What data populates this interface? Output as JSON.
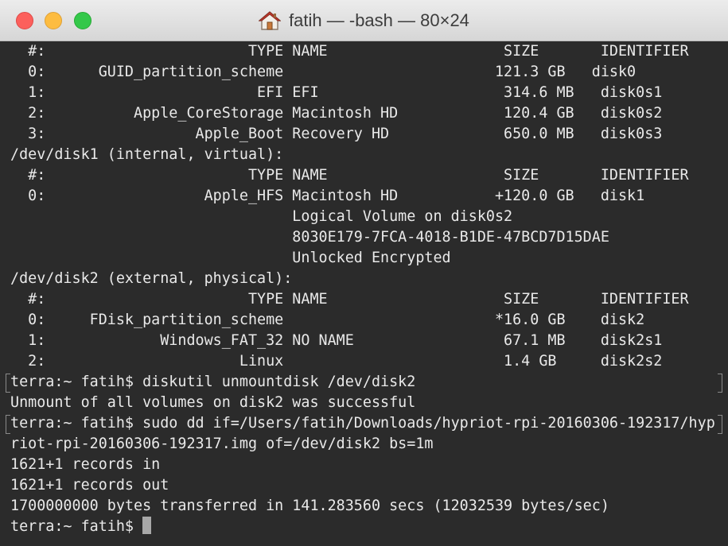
{
  "window": {
    "title": "fatih — -bash — 80×24",
    "colors": {
      "close": "#fc605c",
      "minimize": "#fdbc40",
      "maximize": "#34c84a",
      "terminal_bg": "#2b2b2b",
      "terminal_fg": "#e9e9e9"
    },
    "title_icon": "home-icon"
  },
  "terminal": {
    "lines": [
      "  #:                       TYPE NAME                    SIZE       IDENTIFIER",
      "  0:      GUID_partition_scheme                        121.3 GB   disk0",
      "  1:                        EFI EFI                     314.6 MB   disk0s1",
      "  2:          Apple_CoreStorage Macintosh HD            120.4 GB   disk0s2",
      "  3:                 Apple_Boot Recovery HD             650.0 MB   disk0s3",
      "/dev/disk1 (internal, virtual):",
      "  #:                       TYPE NAME                    SIZE       IDENTIFIER",
      "  0:                  Apple_HFS Macintosh HD           +120.0 GB   disk1",
      "                                Logical Volume on disk0s2",
      "                                8030E179-7FCA-4018-B1DE-47BCD7D15DAE",
      "                                Unlocked Encrypted",
      "/dev/disk2 (external, physical):",
      "  #:                       TYPE NAME                    SIZE       IDENTIFIER",
      "  0:     FDisk_partition_scheme                        *16.0 GB    disk2",
      "  1:             Windows_FAT_32 NO NAME                 67.1 MB    disk2s1",
      "  2:                      Linux                         1.4 GB     disk2s2",
      "terra:~ fatih$ diskutil unmountdisk /dev/disk2",
      "Unmount of all volumes on disk2 was successful",
      "terra:~ fatih$ sudo dd if=/Users/fatih/Downloads/hypriot-rpi-20160306-192317/hyp",
      "riot-rpi-20160306-192317.img of=/dev/disk2 bs=1m",
      "1621+1 records in",
      "1621+1 records out",
      "1700000000 bytes transferred in 141.283560 secs (12032539 bytes/sec)"
    ],
    "prompt": "terra:~ fatih$ "
  }
}
